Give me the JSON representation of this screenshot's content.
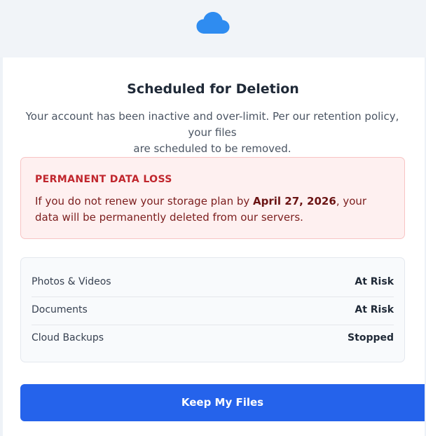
{
  "brand": {
    "icon": "cloud-icon",
    "color": "#2f8cf0"
  },
  "notice": {
    "title": "Scheduled for Deletion",
    "lead_line1": "Your account has been inactive and over-limit. Per our retention policy, your files",
    "lead_line2": "are scheduled to be removed."
  },
  "alert": {
    "title": "PERMANENT DATA LOSS",
    "text_before": "If you do not renew your storage plan by ",
    "deadline": "April 27, 2026",
    "text_after": ", your data will be permanently deleted from our servers.",
    "colors": {
      "background": "#fef0f0",
      "border": "#f8c4c4",
      "title": "#c0262d"
    }
  },
  "status": {
    "rows": [
      {
        "label": "Photos & Videos",
        "value": "At Risk"
      },
      {
        "label": "Documents",
        "value": "At Risk"
      },
      {
        "label": "Cloud Backups",
        "value": "Stopped"
      }
    ]
  },
  "actions": {
    "primary_label": "Keep My Files",
    "primary_color": "#2563eb"
  }
}
